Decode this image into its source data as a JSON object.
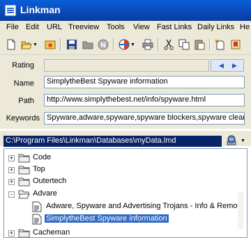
{
  "window": {
    "title": "Linkman"
  },
  "menu": [
    "File",
    "Edit",
    "URL",
    "Treeview",
    "Tools",
    "View",
    "Fast Links",
    "Daily Links",
    "He"
  ],
  "toolbar_icons": [
    "new-document-icon",
    "open-folder-icon",
    "star-icon",
    "save-icon",
    "folder-icon",
    "n-badge-icon",
    "browser-icon",
    "printer-icon",
    "cut-icon",
    "copy-icon",
    "paste-icon",
    "new-item-icon",
    "bookmark-icon"
  ],
  "form": {
    "rating_label": "Rating",
    "name_label": "Name",
    "name_value": "SimplytheBest Spyware information",
    "path_label": "Path",
    "path_value": "http://www.simplythebest.net/info/spyware.html",
    "keywords_label": "Keywords",
    "keywords_value": "Spyware,adware,spyware,spyware blockers,spyware clear"
  },
  "database_path": "C:\\Program Files\\Linkman\\Databases\\myData.lmd",
  "tree": [
    {
      "label": "Code",
      "type": "folder",
      "expander": "+"
    },
    {
      "label": "Top",
      "type": "folder",
      "expander": "+"
    },
    {
      "label": "Outertech",
      "type": "folder",
      "expander": "+"
    },
    {
      "label": "Advare",
      "type": "folder",
      "expander": "-"
    },
    {
      "label": "Adware, Spyware and Advertising Trojans - Info & Remov",
      "type": "link"
    },
    {
      "label": "SimplytheBest Spyware information",
      "type": "link",
      "selected": true
    },
    {
      "label": "Cacheman",
      "type": "folder",
      "expander": "+"
    }
  ]
}
